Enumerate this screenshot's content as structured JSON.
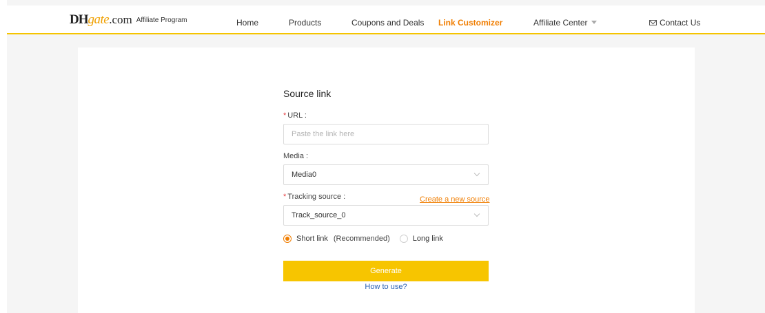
{
  "header": {
    "logo": {
      "dh": "DH",
      "gate": "gate",
      "com": ".com",
      "subtitle": "Affiliate Program"
    },
    "nav": [
      {
        "label": "Home"
      },
      {
        "label": "Products"
      },
      {
        "label": "Coupons and Deals"
      },
      {
        "label": "Link Customizer",
        "active": true
      },
      {
        "label": "Affiliate Center"
      }
    ],
    "contact": "Contact Us"
  },
  "form": {
    "title": "Source link",
    "url": {
      "required_mark": "*",
      "label": "URL :",
      "placeholder": "Paste the link here",
      "value": ""
    },
    "media": {
      "label": "Media :",
      "selected": "Media0"
    },
    "tracking": {
      "required_mark": "*",
      "label": "Tracking source :",
      "selected": "Track_source_0",
      "create_link": "Create a new source"
    },
    "link_type": {
      "short": "Short link",
      "recommended": "(Recommended)",
      "long": "Long link",
      "selected": "short"
    },
    "generate": "Generate",
    "how_to": "How to use?"
  },
  "colors": {
    "accent": "#f07d00",
    "button": "#f7c500",
    "header_border": "#f5c400",
    "link_blue": "#2a62b5",
    "required": "#e4393c"
  }
}
